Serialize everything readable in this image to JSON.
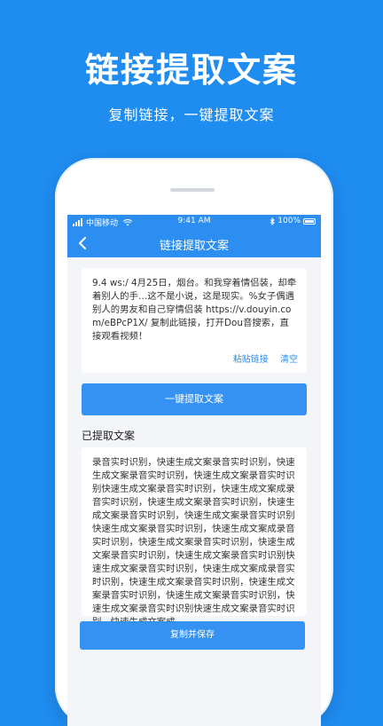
{
  "hero": {
    "title": "链接提取文案",
    "subtitle": "复制链接，一键提取文案"
  },
  "status_bar": {
    "carrier": "中国移动",
    "time": "9:41 AM",
    "battery": "100%"
  },
  "nav": {
    "title": "链接提取文案"
  },
  "input": {
    "text": "9.4 ws:/ 4月25日，烟台。和我穿着情侣装，却牵着别人的手…这不是小说，这是现实。%女子偶遇别人的男友和自己穿情侣装  https://v.douyin.com/eBPcP1X/ 复制此链接，打开Dou音搜索，直接观看视频！",
    "paste_label": "粘贴链接",
    "clear_label": "清空"
  },
  "extract_button": {
    "label": "一键提取文案"
  },
  "result": {
    "section_label": "已提取文案",
    "text": "录音实时识别，快速生成文案录音实时识别，快速生成文案录音实时识别，快速生成文案录音实时识别快速生成文案录音实时识别，快速生成文案成录音实时识别，快速生成文案录音实时识别，快速生成文案录音实时识别，快速生成文案录音实时识别快速生成文案录音实时识别，快速生成文案成录音实时识别，快速生成文案录音实时识别，快速生成文案录音实时识别，快速生成文案录音实时识别快速生成文案录音实时识别，快速生成文案成录音实时识别，快速生成文案录音实时识别，快速生成文案录音实时识别，快速生成文案录音实时识别，快速生成文案录音实时识别快速生成文案录音实时识别，快速生成文案成"
  },
  "copy_button": {
    "label": "复制并保存"
  },
  "colors": {
    "background": "#1f8cf0",
    "accent": "#2b8ef0",
    "button": "#3592f2"
  }
}
